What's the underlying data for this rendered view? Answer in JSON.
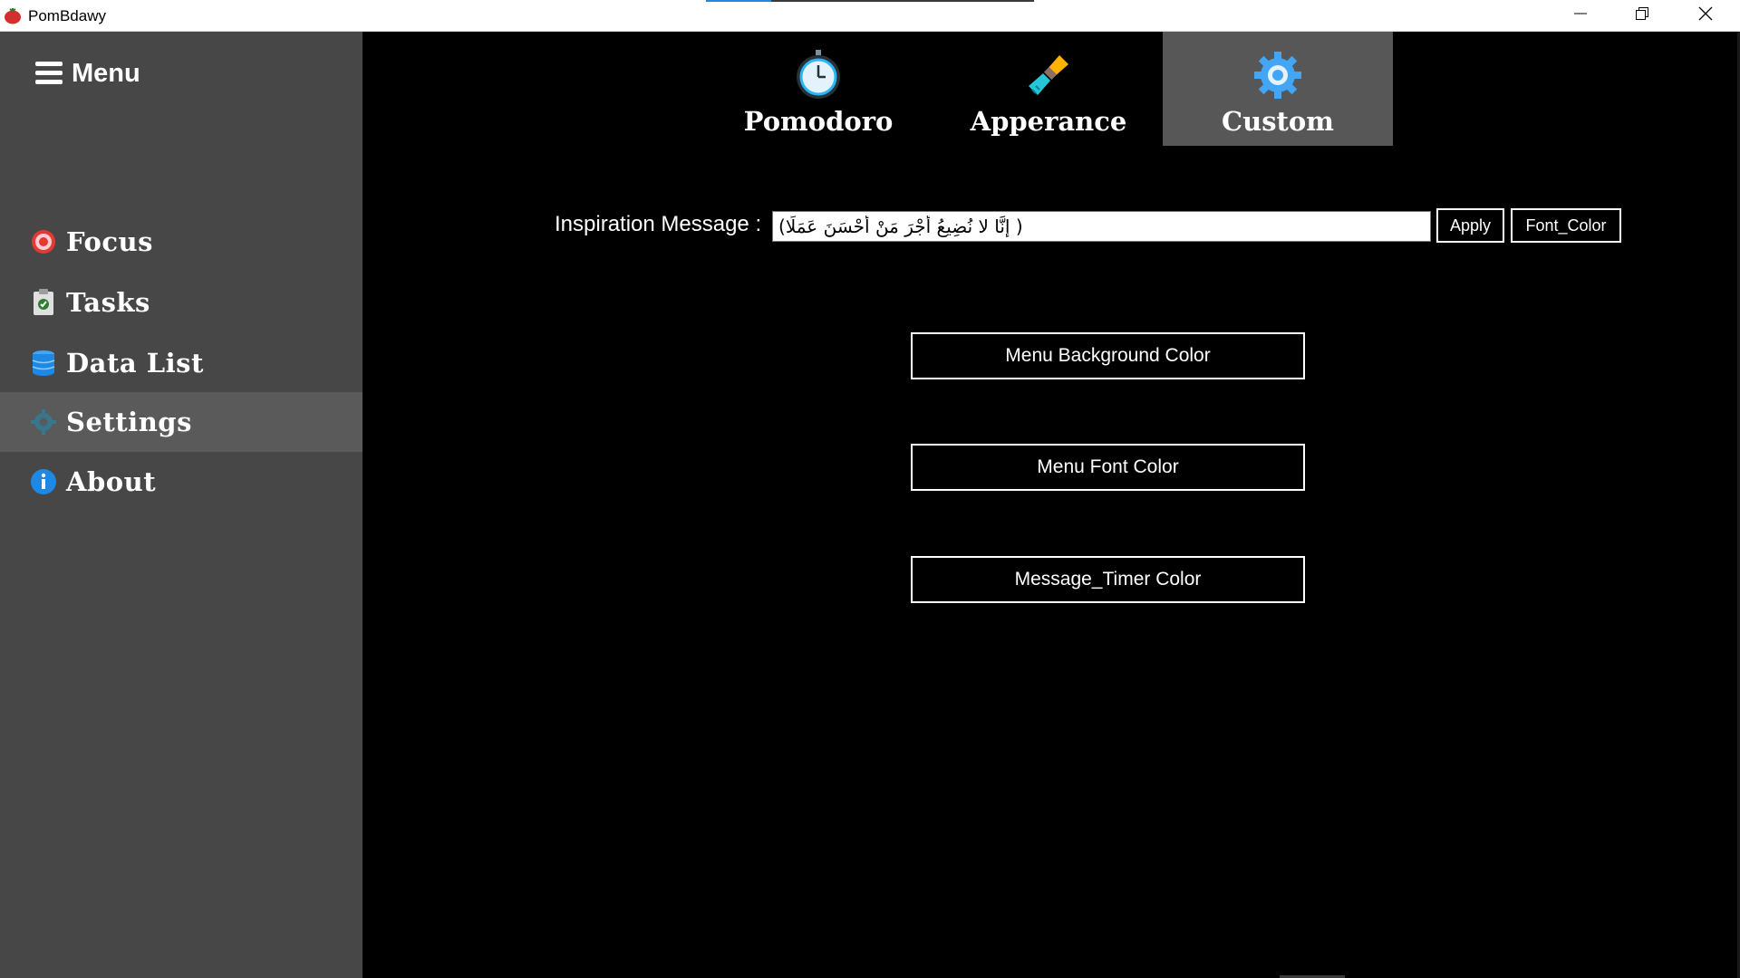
{
  "window": {
    "title": "PomBdawy",
    "controls": [
      "minimize-icon",
      "restore-icon",
      "close-icon"
    ]
  },
  "sidebar": {
    "menu_label": "Menu",
    "items": [
      {
        "label": "Focus",
        "icon": "target-icon"
      },
      {
        "label": "Tasks",
        "icon": "clipboard-icon"
      },
      {
        "label": "Data List",
        "icon": "database-icon"
      },
      {
        "label": "Settings",
        "icon": "gear-icon",
        "active": true
      },
      {
        "label": "About",
        "icon": "info-icon"
      }
    ]
  },
  "tabs": [
    {
      "label": "Pomodoro",
      "icon": "stopwatch-icon"
    },
    {
      "label": "Apperance",
      "icon": "paintbrush-icon"
    },
    {
      "label": "Custom",
      "icon": "gear-icon",
      "active": true
    }
  ],
  "inspiration": {
    "label": "Inspiration Message :",
    "value": "(إِنَّا لا نُضِيعُ أَجْرَ مَنْ أَحْسَنَ عَمَلًا )",
    "apply_label": "Apply",
    "font_color_label": "Font_Color"
  },
  "color_buttons": {
    "menu_background": "Menu Background Color",
    "menu_font": "Menu Font Color",
    "message_timer": "Message_Timer Color"
  },
  "colors": {
    "sidebar_bg": "#474747",
    "sidebar_active": "#5a5a5a",
    "content_bg": "#000000",
    "tab_active": "#575757",
    "text": "#ffffff"
  }
}
